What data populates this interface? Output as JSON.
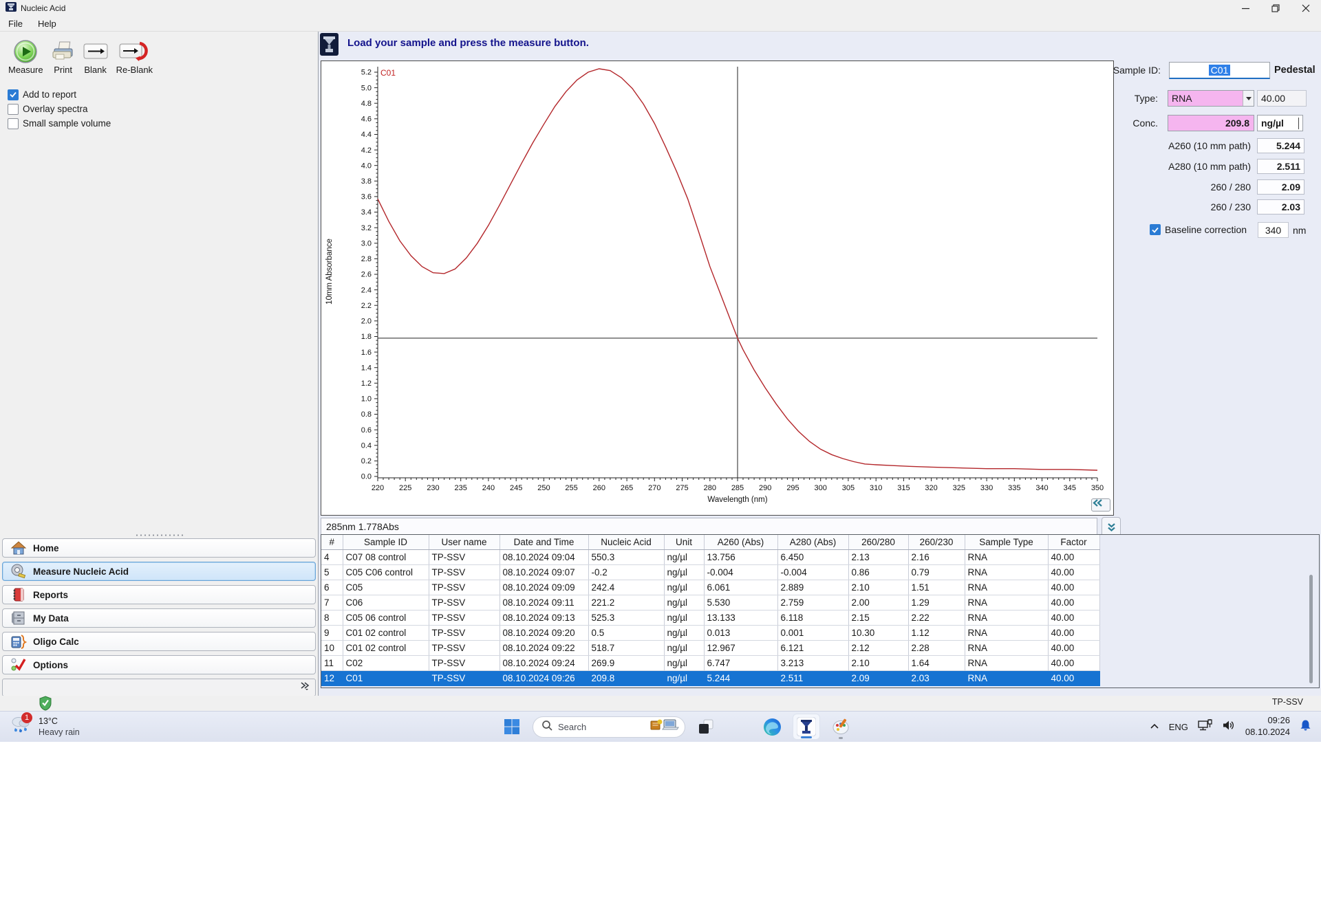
{
  "window": {
    "title": "Nucleic Acid",
    "menu": [
      "File",
      "Help"
    ]
  },
  "toolbar": {
    "buttons": [
      {
        "label": "Measure"
      },
      {
        "label": "Print"
      },
      {
        "label": "Blank"
      },
      {
        "label": "Re-Blank"
      }
    ]
  },
  "options": {
    "checkboxes": [
      {
        "label": "Add to report",
        "checked": true
      },
      {
        "label": "Overlay spectra",
        "checked": false
      },
      {
        "label": "Small sample volume",
        "checked": false
      }
    ]
  },
  "message_bar": {
    "text": "Load your sample and press the measure button."
  },
  "sidebar": {
    "items": [
      {
        "label": "Home"
      },
      {
        "label": "Measure Nucleic Acid",
        "selected": true
      },
      {
        "label": "Reports"
      },
      {
        "label": "My Data"
      },
      {
        "label": "Oligo Calc"
      },
      {
        "label": "Options"
      }
    ]
  },
  "sample_panel": {
    "sample_id_label": "Sample ID:",
    "sample_id_value": "C01",
    "mode": "Pedestal",
    "type_label": "Type:",
    "type_value": "RNA",
    "factor_value": "40.00",
    "conc_label": "Conc.",
    "conc_value": "209.8",
    "conc_unit": "ng/µl",
    "rows": [
      {
        "label": "A260 (10 mm path)",
        "value": "5.244"
      },
      {
        "label": "A280 (10 mm path)",
        "value": "2.511"
      },
      {
        "label": "260 / 280",
        "value": "2.09"
      },
      {
        "label": "260 / 230",
        "value": "2.03"
      }
    ],
    "baseline": {
      "label": "Baseline correction",
      "checked": true,
      "value": "340",
      "unit": "nm"
    }
  },
  "chart_status": {
    "readout": "285nm 1.778Abs"
  },
  "chart_data": {
    "type": "line",
    "series_label": "C01",
    "xlabel": "Wavelength (nm)",
    "ylabel": "10mm Absorbance",
    "xlim": [
      220,
      350
    ],
    "ylim": [
      0,
      5.2
    ],
    "x_major_tick": 5,
    "y_major_tick": 0.2,
    "line_color": "#b3262a",
    "crosshair": {
      "x": 285,
      "y": 1.778
    },
    "points": [
      [
        220,
        3.57
      ],
      [
        222,
        3.28
      ],
      [
        224,
        3.03
      ],
      [
        226,
        2.84
      ],
      [
        228,
        2.7
      ],
      [
        230,
        2.62
      ],
      [
        232,
        2.61
      ],
      [
        234,
        2.67
      ],
      [
        236,
        2.81
      ],
      [
        238,
        3.0
      ],
      [
        240,
        3.23
      ],
      [
        242,
        3.49
      ],
      [
        244,
        3.76
      ],
      [
        246,
        4.03
      ],
      [
        248,
        4.29
      ],
      [
        250,
        4.53
      ],
      [
        252,
        4.76
      ],
      [
        254,
        4.95
      ],
      [
        256,
        5.1
      ],
      [
        258,
        5.2
      ],
      [
        260,
        5.244
      ],
      [
        262,
        5.22
      ],
      [
        264,
        5.13
      ],
      [
        266,
        4.99
      ],
      [
        268,
        4.79
      ],
      [
        270,
        4.54
      ],
      [
        272,
        4.24
      ],
      [
        274,
        3.92
      ],
      [
        276,
        3.57
      ],
      [
        278,
        3.14
      ],
      [
        280,
        2.7
      ],
      [
        282,
        2.33
      ],
      [
        284,
        1.96
      ],
      [
        285,
        1.778
      ],
      [
        286,
        1.63
      ],
      [
        288,
        1.37
      ],
      [
        290,
        1.14
      ],
      [
        292,
        0.93
      ],
      [
        294,
        0.74
      ],
      [
        296,
        0.58
      ],
      [
        298,
        0.45
      ],
      [
        300,
        0.35
      ],
      [
        302,
        0.28
      ],
      [
        304,
        0.23
      ],
      [
        306,
        0.19
      ],
      [
        308,
        0.16
      ],
      [
        310,
        0.15
      ],
      [
        313,
        0.14
      ],
      [
        316,
        0.13
      ],
      [
        320,
        0.12
      ],
      [
        325,
        0.11
      ],
      [
        330,
        0.1
      ],
      [
        335,
        0.1
      ],
      [
        340,
        0.09
      ],
      [
        345,
        0.09
      ],
      [
        350,
        0.08
      ]
    ]
  },
  "table": {
    "columns": [
      "#",
      "Sample ID",
      "User name",
      "Date and Time",
      "Nucleic Acid",
      "Unit",
      "A260 (Abs)",
      "A280 (Abs)",
      "260/280",
      "260/230",
      "Sample Type",
      "Factor"
    ],
    "rows": [
      [
        "4",
        "C07 08 control",
        "TP-SSV",
        "08.10.2024 09:04",
        "550.3",
        "ng/µl",
        "13.756",
        "6.450",
        "2.13",
        "2.16",
        "RNA",
        "40.00"
      ],
      [
        "5",
        "C05 C06 control",
        "TP-SSV",
        "08.10.2024 09:07",
        "-0.2",
        "ng/µl",
        "-0.004",
        "-0.004",
        "0.86",
        "0.79",
        "RNA",
        "40.00"
      ],
      [
        "6",
        "C05",
        "TP-SSV",
        "08.10.2024 09:09",
        "242.4",
        "ng/µl",
        "6.061",
        "2.889",
        "2.10",
        "1.51",
        "RNA",
        "40.00"
      ],
      [
        "7",
        "C06",
        "TP-SSV",
        "08.10.2024 09:11",
        "221.2",
        "ng/µl",
        "5.530",
        "2.759",
        "2.00",
        "1.29",
        "RNA",
        "40.00"
      ],
      [
        "8",
        "C05 06 control",
        "TP-SSV",
        "08.10.2024 09:13",
        "525.3",
        "ng/µl",
        "13.133",
        "6.118",
        "2.15",
        "2.22",
        "RNA",
        "40.00"
      ],
      [
        "9",
        "C01 02 control",
        "TP-SSV",
        "08.10.2024 09:20",
        "0.5",
        "ng/µl",
        "0.013",
        "0.001",
        "10.30",
        "1.12",
        "RNA",
        "40.00"
      ],
      [
        "10",
        "C01 02 control",
        "TP-SSV",
        "08.10.2024 09:22",
        "518.7",
        "ng/µl",
        "12.967",
        "6.121",
        "2.12",
        "2.28",
        "RNA",
        "40.00"
      ],
      [
        "11",
        "C02",
        "TP-SSV",
        "08.10.2024 09:24",
        "269.9",
        "ng/µl",
        "6.747",
        "3.213",
        "2.10",
        "1.64",
        "RNA",
        "40.00"
      ],
      [
        "12",
        "C01",
        "TP-SSV",
        "08.10.2024 09:26",
        "209.8",
        "ng/µl",
        "5.244",
        "2.511",
        "2.09",
        "2.03",
        "RNA",
        "40.00"
      ]
    ],
    "selected_row_index": 8
  },
  "status_strip": {
    "user": "TP-SSV"
  },
  "taskbar": {
    "weather": {
      "temp": "13°C",
      "condition": "Heavy rain",
      "badge": "1"
    },
    "search_placeholder": "Search",
    "language": "ENG",
    "clock": {
      "time": "09:26",
      "date": "08.10.2024"
    }
  }
}
